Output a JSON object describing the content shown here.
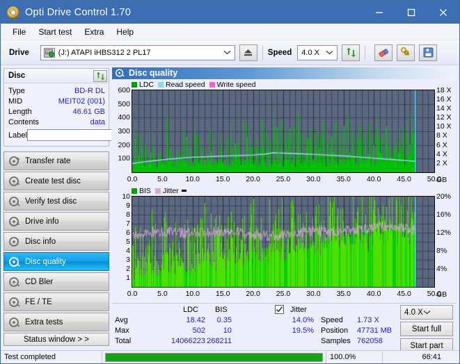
{
  "window": {
    "title": "Opti Drive Control 1.70",
    "icon": "disc-icon",
    "minimize": "minimize-button",
    "maximize": "maximize-button",
    "close": "close-button"
  },
  "menu": {
    "items": [
      "File",
      "Start test",
      "Extra",
      "Help"
    ]
  },
  "toolbar": {
    "drive_label": "Drive",
    "drive_value": "(J:)   ATAPI iHBS312   2 PL17",
    "eject_icon": "eject-icon",
    "speed_label": "Speed",
    "speed_value": "4.0 X",
    "refresh_icon": "refresh-icon",
    "erase_icon": "eraser-icon",
    "keys_icon": "keys-icon",
    "save_icon": "save-icon"
  },
  "disc": {
    "header": "Disc",
    "refresh_icon": "refresh-icon",
    "rows": [
      {
        "key": "Type",
        "value": "BD-R DL"
      },
      {
        "key": "MID",
        "value": "MEIT02 (001)"
      },
      {
        "key": "Length",
        "value": "46.61 GB"
      },
      {
        "key": "Contents",
        "value": "data"
      }
    ],
    "label_key": "Label",
    "label_value": "",
    "label_placeholder": "",
    "label_button_icon": "cd-icon"
  },
  "nav": {
    "items": [
      {
        "label": "Transfer rate",
        "selected": false
      },
      {
        "label": "Create test disc",
        "selected": false
      },
      {
        "label": "Verify test disc",
        "selected": false
      },
      {
        "label": "Drive info",
        "selected": false
      },
      {
        "label": "Disc info",
        "selected": false
      },
      {
        "label": "Disc quality",
        "selected": true
      },
      {
        "label": "CD Bler",
        "selected": false
      },
      {
        "label": "FE / TE",
        "selected": false
      },
      {
        "label": "Extra tests",
        "selected": false
      }
    ],
    "status_window": "Status window > >"
  },
  "panel": {
    "title": "Disc quality",
    "icon": "disc-quality-icon"
  },
  "stats": {
    "col_ldc": "LDC",
    "col_bis": "BIS",
    "row_avg": "Avg",
    "row_max": "Max",
    "row_total": "Total",
    "avg_ldc": "18.42",
    "avg_bis": "0.35",
    "max_ldc": "502",
    "max_bis": "10",
    "total_ldc": "14066223",
    "total_bis": "268211",
    "jitter_label": "Jitter",
    "jitter_checked": true,
    "jitter_avg": "14.0%",
    "jitter_max": "19.5%",
    "speed_label": "Speed",
    "speed_value": "1.73 X",
    "position_label": "Position",
    "position_value": "47731 MB",
    "samples_label": "Samples",
    "samples_value": "762058",
    "speed_select": "4.0 X",
    "start_full": "Start full",
    "start_part": "Start part"
  },
  "statusbar": {
    "message": "Test completed",
    "progress_pct": "100.0%",
    "progress_value": 100,
    "elapsed": "66:41"
  },
  "colors": {
    "titlebar": "#3d6eb4",
    "accent_value": "#1a1ad0",
    "ldc_green": "#00c000",
    "read_speed": "#8ad7f0",
    "write_speed": "#ff5ed2",
    "jitter_pink": "#d9a8d9",
    "plot_bg": "#5b6880",
    "progress_green": "#13a413",
    "selection_blue": "#13a0e8"
  },
  "chart_data": [
    {
      "id": "ldc-chart",
      "type": "bar",
      "title": "",
      "xlabel": "GB",
      "ylabel": "",
      "legend": [
        {
          "label": "LDC",
          "color": "#00a000"
        },
        {
          "label": "Read speed",
          "color": "#8ad7f0"
        },
        {
          "label": "Write speed",
          "color": "#ff5ed2"
        }
      ],
      "legend_position": "top-left",
      "grid": true,
      "xlim": [
        0,
        50
      ],
      "ylim": [
        0,
        600
      ],
      "xticks": [
        "0.0",
        "5.0",
        "10.0",
        "15.0",
        "20.0",
        "25.0",
        "30.0",
        "35.0",
        "40.0",
        "45.0",
        "50.0"
      ],
      "yticks": [
        "100",
        "200",
        "300",
        "400",
        "500",
        "600"
      ],
      "y2ticks": [
        "2 X",
        "4 X",
        "6 X",
        "8 X",
        "10 X",
        "12 X",
        "14 X",
        "16 X",
        "18 X"
      ],
      "y2lim": [
        0,
        18
      ],
      "data_end_gb": 46.9,
      "series": [
        {
          "name": "LDC",
          "type": "bar",
          "color": "#00c000",
          "baseline": [
            40,
            55,
            48,
            62,
            45,
            58,
            70,
            52,
            44,
            60,
            50,
            68,
            42,
            55,
            47,
            63,
            58,
            46,
            70,
            54,
            49,
            61,
            52,
            66,
            44,
            57,
            72,
            48,
            53,
            65,
            46,
            59,
            51,
            68,
            43,
            56,
            62,
            50,
            58,
            47,
            66,
            54,
            60,
            48,
            71,
            52,
            57,
            63,
            45,
            59,
            68,
            51,
            55,
            62,
            47,
            70,
            53,
            58,
            66,
            49,
            61,
            55,
            72,
            50,
            64,
            57,
            68,
            46,
            59,
            53,
            70,
            62,
            51,
            66,
            57,
            74,
            48,
            61,
            55,
            69,
            63,
            52,
            71,
            58,
            66,
            49,
            74,
            57,
            62,
            70,
            54,
            66,
            59,
            76,
            51,
            68,
            62,
            73,
            57,
            66,
            70,
            59,
            78,
            63,
            72,
            55,
            80,
            66,
            61,
            74,
            68,
            57,
            82,
            63,
            70,
            59,
            76,
            66,
            84,
            61,
            72,
            65,
            79,
            58,
            86,
            68,
            74,
            62,
            81,
            70,
            65,
            88,
            72,
            60,
            83,
            76,
            68,
            90,
            64,
            78,
            72,
            86,
            66,
            92,
            70,
            80,
            75,
            88,
            68,
            95,
            74,
            82,
            70,
            90,
            78,
            86,
            72,
            98,
            80,
            75,
            88,
            94,
            72,
            102,
            78,
            86,
            92,
            70,
            100,
            82,
            76,
            96,
            88,
            74,
            104,
            80,
            92,
            86,
            78,
            108,
            84,
            96,
            90,
            76,
            112,
            82,
            100,
            94,
            86,
            78,
            106,
            92,
            84,
            116,
            88,
            96,
            80,
            102,
            90
          ],
          "spikes": [
            {
              "x": 0.4,
              "y": 350
            },
            {
              "x": 1.1,
              "y": 290
            },
            {
              "x": 1.5,
              "y": 220
            },
            {
              "x": 2.2,
              "y": 200
            },
            {
              "x": 2.9,
              "y": 310
            },
            {
              "x": 3.4,
              "y": 200
            },
            {
              "x": 4.6,
              "y": 150
            },
            {
              "x": 5.8,
              "y": 400
            },
            {
              "x": 6.2,
              "y": 180
            },
            {
              "x": 7.3,
              "y": 160
            },
            {
              "x": 8.5,
              "y": 300
            },
            {
              "x": 9.0,
              "y": 260
            },
            {
              "x": 9.6,
              "y": 210
            },
            {
              "x": 10.2,
              "y": 400
            },
            {
              "x": 10.8,
              "y": 280
            },
            {
              "x": 11.4,
              "y": 250
            },
            {
              "x": 12.1,
              "y": 190
            },
            {
              "x": 12.9,
              "y": 310
            },
            {
              "x": 13.5,
              "y": 265
            },
            {
              "x": 14.2,
              "y": 300
            },
            {
              "x": 14.9,
              "y": 290
            },
            {
              "x": 15.6,
              "y": 240
            },
            {
              "x": 16.2,
              "y": 360
            },
            {
              "x": 16.9,
              "y": 300
            },
            {
              "x": 17.5,
              "y": 230
            },
            {
              "x": 18.3,
              "y": 390
            },
            {
              "x": 18.9,
              "y": 370
            },
            {
              "x": 19.5,
              "y": 260
            },
            {
              "x": 20.2,
              "y": 300
            },
            {
              "x": 20.9,
              "y": 240
            },
            {
              "x": 21.4,
              "y": 390
            },
            {
              "x": 22.1,
              "y": 300
            },
            {
              "x": 22.8,
              "y": 250
            },
            {
              "x": 23.4,
              "y": 470
            },
            {
              "x": 24.0,
              "y": 330
            },
            {
              "x": 24.7,
              "y": 390
            },
            {
              "x": 25.3,
              "y": 300
            },
            {
              "x": 26.0,
              "y": 250
            },
            {
              "x": 26.7,
              "y": 330
            },
            {
              "x": 27.4,
              "y": 430
            },
            {
              "x": 28.1,
              "y": 290
            },
            {
              "x": 28.8,
              "y": 260
            },
            {
              "x": 29.5,
              "y": 330
            },
            {
              "x": 30.2,
              "y": 290
            },
            {
              "x": 30.9,
              "y": 250
            },
            {
              "x": 31.6,
              "y": 370
            },
            {
              "x": 32.2,
              "y": 300
            },
            {
              "x": 32.9,
              "y": 260
            },
            {
              "x": 33.6,
              "y": 320
            },
            {
              "x": 34.3,
              "y": 290
            },
            {
              "x": 35.0,
              "y": 340
            },
            {
              "x": 35.7,
              "y": 410
            },
            {
              "x": 36.4,
              "y": 300
            },
            {
              "x": 37.1,
              "y": 260
            },
            {
              "x": 37.8,
              "y": 330
            },
            {
              "x": 38.5,
              "y": 290
            },
            {
              "x": 39.2,
              "y": 360
            },
            {
              "x": 39.9,
              "y": 280
            },
            {
              "x": 40.6,
              "y": 320
            },
            {
              "x": 41.3,
              "y": 250
            },
            {
              "x": 42.0,
              "y": 340
            },
            {
              "x": 42.7,
              "y": 300
            },
            {
              "x": 43.4,
              "y": 270
            },
            {
              "x": 44.1,
              "y": 330
            },
            {
              "x": 44.8,
              "y": 290
            },
            {
              "x": 45.5,
              "y": 380
            },
            {
              "x": 46.2,
              "y": 430
            },
            {
              "x": 46.6,
              "y": 290
            }
          ]
        },
        {
          "name": "Read speed",
          "type": "line",
          "color": "#9fdcf2",
          "axis": "y2",
          "points": [
            [
              0.0,
              1.9
            ],
            [
              2.0,
              2.3
            ],
            [
              4.0,
              2.6
            ],
            [
              6.0,
              2.9
            ],
            [
              8.0,
              3.1
            ],
            [
              10.0,
              3.3
            ],
            [
              12.0,
              3.4
            ],
            [
              14.0,
              3.5
            ],
            [
              16.0,
              3.6
            ],
            [
              18.0,
              3.7
            ],
            [
              20.0,
              3.8
            ],
            [
              22.0,
              4.0
            ],
            [
              23.5,
              4.3
            ],
            [
              24.0,
              4.25
            ],
            [
              26.0,
              4.15
            ],
            [
              28.0,
              4.05
            ],
            [
              30.0,
              3.95
            ],
            [
              32.0,
              3.8
            ],
            [
              34.0,
              3.65
            ],
            [
              36.0,
              3.5
            ],
            [
              38.0,
              3.3
            ],
            [
              40.0,
              3.1
            ],
            [
              42.0,
              2.9
            ],
            [
              44.0,
              2.7
            ],
            [
              46.0,
              2.5
            ],
            [
              46.9,
              2.4
            ]
          ]
        }
      ],
      "cursor_line": {
        "x": 46.9,
        "color": "#3dd7ff"
      }
    },
    {
      "id": "bis-jitter-chart",
      "type": "bar",
      "title": "",
      "xlabel": "GB",
      "ylabel": "",
      "legend": [
        {
          "label": "BIS",
          "color": "#00a000"
        },
        {
          "label": "Jitter",
          "color": "#d9a8d9"
        }
      ],
      "legend_position": "top-left",
      "grid": true,
      "xlim": [
        0,
        50
      ],
      "ylim": [
        0,
        10
      ],
      "xticks": [
        "0.0",
        "5.0",
        "10.0",
        "15.0",
        "20.0",
        "25.0",
        "30.0",
        "35.0",
        "40.0",
        "45.0",
        "50.0"
      ],
      "yticks": [
        "1",
        "2",
        "3",
        "4",
        "5",
        "6",
        "7",
        "8",
        "9",
        "10"
      ],
      "y2ticks": [
        "4%",
        "8%",
        "12%",
        "16%",
        "20%"
      ],
      "y2lim": [
        0,
        22
      ],
      "data_end_gb": 46.9,
      "series": [
        {
          "name": "BIS",
          "type": "bar",
          "color": "#00c000",
          "note": "dense bars rising from ~1 at 0 GB to ~6 near 46 GB, with frequent spikes to 9-10"
        },
        {
          "name": "Jitter",
          "type": "line",
          "color": "#d9a8d9",
          "axis": "y2",
          "note": "noisy band averaging 14.0%, peaking 19.5%, drawn between ~12% and ~16%"
        }
      ],
      "cursor_line": {
        "x": 46.9,
        "color": "#3dd7ff"
      }
    }
  ]
}
